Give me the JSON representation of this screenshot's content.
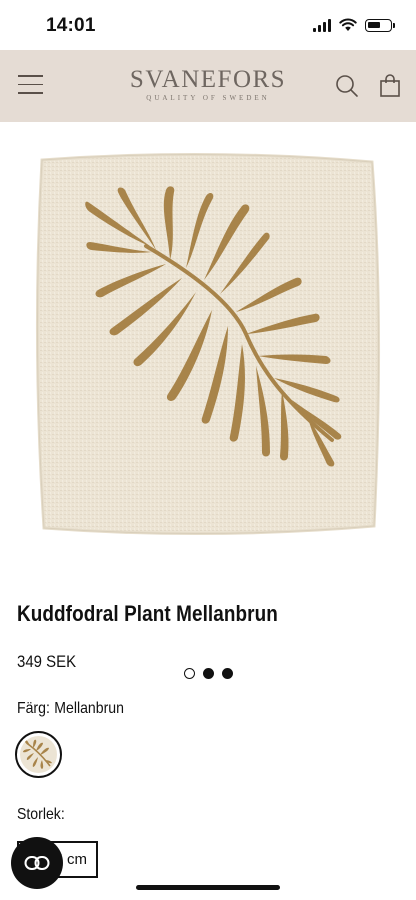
{
  "status_bar": {
    "time": "14:01",
    "battery_level": 0.55
  },
  "header": {
    "brand_name": "SVANEFORS",
    "brand_tagline": "QUALITY OF SWEDEN",
    "icons": [
      "menu-icon",
      "search-icon",
      "shopping-bag-icon"
    ],
    "background_color": "#e5dcd4"
  },
  "gallery": {
    "slide_count": 3,
    "active_slide": 1
  },
  "product": {
    "title": "Kuddfodral Plant Mellanbrun",
    "price": "349 SEK",
    "color_label": "Färg:",
    "color_value": "Mellanbrun",
    "size_label": "Storlek:",
    "size_option": "5 cm",
    "fabric_color": "#ece4d4",
    "print_color": "#a8844a"
  },
  "chat": {
    "icon": "chat-link-icon"
  }
}
